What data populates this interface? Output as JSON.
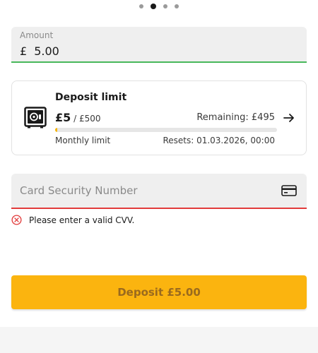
{
  "pager": {
    "page_count": 4,
    "active_index": 1
  },
  "amount": {
    "label": "Amount",
    "currency_symbol": "£",
    "value": "5.00"
  },
  "deposit_limit": {
    "title": "Deposit limit",
    "used": "£5",
    "limit": "/ £500",
    "remaining": "Remaining: £495",
    "period": "Monthly limit",
    "resets": "Resets: 01.03.2026, 00:00",
    "progress_fraction": 0.01,
    "icon": "safe-icon",
    "action_icon": "arrow-right-icon"
  },
  "cvv": {
    "placeholder": "Card Security Number",
    "value": "",
    "icon": "credit-card-icon",
    "error": "Please enter a valid CVV.",
    "error_icon": "error-circle-icon"
  },
  "deposit_button": {
    "label": "Deposit £5.00"
  },
  "colors": {
    "accent": "#fbb40f",
    "progress": "#f5b301",
    "valid": "#48b85b",
    "error": "#e23b3b"
  }
}
